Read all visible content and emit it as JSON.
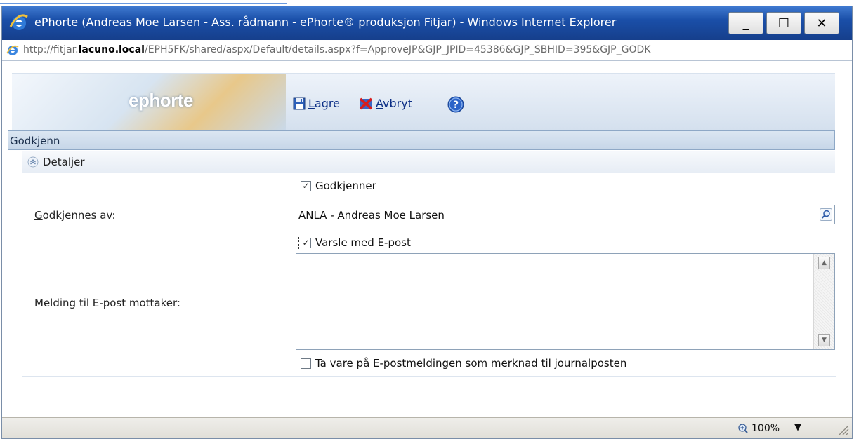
{
  "window": {
    "title": "ePhorte (Andreas Moe Larsen - Ass. rådmann - ePhorte® produksjon Fitjar) - Windows Internet Explorer",
    "minimize_label": "_",
    "maximize_label": "☐",
    "close_label": "✕"
  },
  "address": {
    "prefix": "http://fitjar.",
    "host": "lacuno.local",
    "path": "/EPH5FK/shared/aspx/Default/details.aspx?f=ApproveJP&GJP_JPID=45386&GJP_SBHID=395&GJP_GODK"
  },
  "app": {
    "logo_text": "ephorte",
    "toolbar": {
      "save_accel": "L",
      "save_rest": "agre",
      "cancel_accel": "A",
      "cancel_rest": "vbryt"
    }
  },
  "section": {
    "title": "Godkjenn",
    "subsection_title": "Detaljer"
  },
  "form": {
    "approver_checkbox": {
      "label": "Godkjenner",
      "checked": true
    },
    "approved_by": {
      "label_accel": "G",
      "label_rest": "odkjennes av:",
      "value": "ANLA - Andreas Moe Larsen"
    },
    "notify_checkbox": {
      "label": "Varsle med E-post",
      "checked": true
    },
    "message": {
      "label": "Melding til E-post mottaker:",
      "value": ""
    },
    "keep_checkbox": {
      "label": "Ta vare på E-postmeldingen som merknad til journalposten",
      "checked": false
    }
  },
  "status": {
    "zoom": "100%"
  },
  "colors": {
    "title_bar": "#1a4fa8",
    "toolbar_text": "#0c2f86",
    "section_bar": "#c6d6e8",
    "status_bar": "#e1dfd8"
  }
}
